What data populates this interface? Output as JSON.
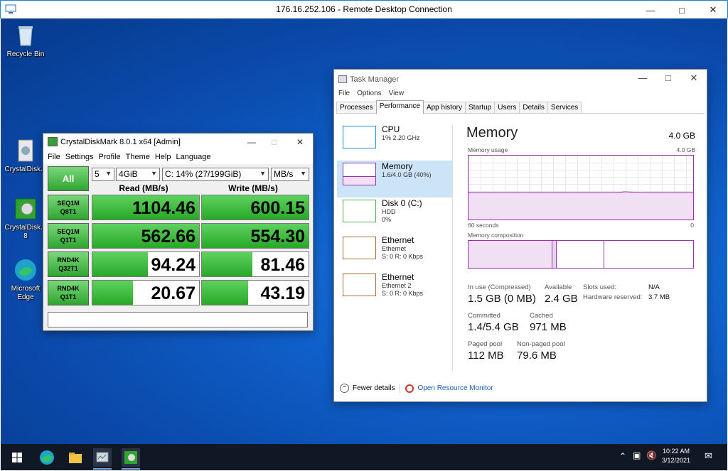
{
  "rdp": {
    "title": "176.16.252.106 - Remote Desktop Connection"
  },
  "desktop": {
    "icons": [
      {
        "label": "Recycle Bin"
      },
      {
        "label": "CrystalDisk..."
      },
      {
        "label": "CrystalDisk... 8"
      },
      {
        "label": "Microsoft Edge"
      }
    ]
  },
  "cdm": {
    "title": "CrystalDiskMark 8.0.1 x64 [Admin]",
    "menu": [
      "File",
      "Settings",
      "Profile",
      "Theme",
      "Help",
      "Language"
    ],
    "all_label": "All",
    "count": "5",
    "size": "4GiB",
    "drive": "C: 14% (27/199GiB)",
    "unit": "MB/s",
    "read_header": "Read (MB/s)",
    "write_header": "Write (MB/s)",
    "rows": [
      {
        "l1": "SEQ1M",
        "l2": "Q8T1",
        "read": "1104.46",
        "write": "600.15",
        "read_frac": 1.0,
        "write_frac": 1.0
      },
      {
        "l1": "SEQ1M",
        "l2": "Q1T1",
        "read": "562.66",
        "write": "554.30",
        "read_frac": 1.0,
        "write_frac": 1.0
      },
      {
        "l1": "RND4K",
        "l2": "Q32T1",
        "read": "94.24",
        "write": "81.46",
        "read_frac": 0.52,
        "write_frac": 0.47
      },
      {
        "l1": "RND4K",
        "l2": "Q1T1",
        "read": "20.67",
        "write": "43.19",
        "read_frac": 0.38,
        "write_frac": 0.43
      }
    ]
  },
  "tm": {
    "title": "Task Manager",
    "menu": [
      "File",
      "Options",
      "View"
    ],
    "tabs": [
      "Processes",
      "Performance",
      "App history",
      "Startup",
      "Users",
      "Details",
      "Services"
    ],
    "side": [
      {
        "name": "CPU",
        "sub1": "1% 2.20 GHz",
        "sub2": "",
        "color": "#1b8fd6"
      },
      {
        "name": "Memory",
        "sub1": "1.6/4.0 GB (40%)",
        "sub2": "",
        "color": "#9b2fae"
      },
      {
        "name": "Disk 0 (C:)",
        "sub1": "HDD",
        "sub2": "0%",
        "color": "#4db14d"
      },
      {
        "name": "Ethernet",
        "sub1": "Ethernet",
        "sub2": "S: 0 R: 0 Kbps",
        "color": "#a76c3a"
      },
      {
        "name": "Ethernet",
        "sub1": "Ethernet 2",
        "sub2": "S: 0 R: 0 Kbps",
        "color": "#a76c3a"
      }
    ],
    "heading": "Memory",
    "total": "4.0 GB",
    "usage_label": "Memory usage",
    "usage_max": "4.0 GB",
    "seconds": "60 seconds",
    "zero": "0",
    "composition_label": "Memory composition",
    "stats": {
      "in_use_label": "In use (Compressed)",
      "in_use": "1.5 GB (0 MB)",
      "available_label": "Available",
      "available": "2.4 GB",
      "slots_label": "Slots used:",
      "slots": "N/A",
      "hw_label": "Hardware reserved:",
      "hw": "3.7 MB",
      "committed_label": "Committed",
      "committed": "1.4/5.4 GB",
      "cached_label": "Cached",
      "cached": "971 MB",
      "paged_label": "Paged pool",
      "paged": "112 MB",
      "nonpaged_label": "Non-paged pool",
      "nonpaged": "79.6 MB"
    },
    "fewer_details": "Fewer details",
    "resource_monitor": "Open Resource Monitor"
  },
  "taskbar": {
    "time": "10:22 AM",
    "date": "3/12/2021"
  }
}
